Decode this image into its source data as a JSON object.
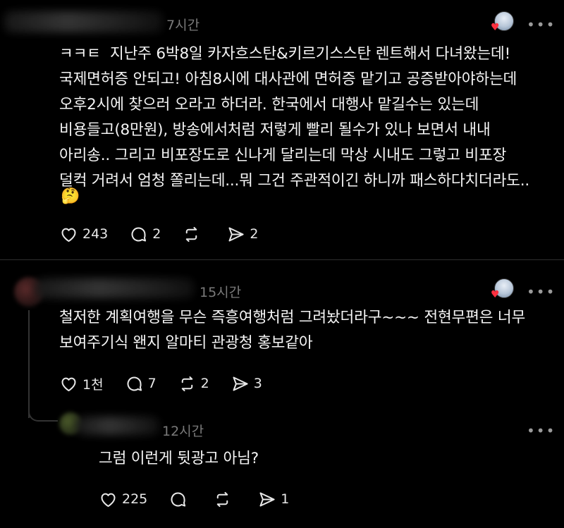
{
  "posts": [
    {
      "time": "7시간",
      "body": "ㅋㅋㅌ  지난주 6박8일 카자흐스탄&키르기스스탄 렌트해서 다녀왔는데!\n국제면허증 안되고! 아침8시에 대사관에 면허증 맡기고 공증받아야하는데\n오후2시에 찾으러 오라고 하더라. 한국에서 대행사 맡길수는 있는데\n비용들고(8만원), 방송에서처럼 저렇게 빨리 될수가 있나 보면서 내내\n아리송.. 그리고 비포장도로 신나게 달리는데 막상 시내도 그렇고 비포장\n덜컥 거려서 엄청 쫄리는데...뭐 그건 주관적이긴 하니까 패스하다치더라도..",
      "emoji": "🤔",
      "likes": "243",
      "comments": "2",
      "reposts": "",
      "shares": "2"
    },
    {
      "time": "15시간",
      "body": "철저한 계획여행을 무슨 즉흥여행처럼 그려놨더라구~~~ 전현무편은 너무\n보여주기식 왠지 알마티 관광청 홍보같아",
      "likes": "1천",
      "comments": "7",
      "reposts": "2",
      "shares": "3"
    },
    {
      "time": "12시간",
      "body": "그럼 이런게 뒷광고 아님?",
      "likes": "225",
      "comments": "",
      "reposts": "",
      "shares": "1"
    }
  ],
  "icons": {
    "like": "heart-icon",
    "comment": "comment-icon",
    "repost": "repost-icon",
    "share": "share-icon",
    "more": "more-icon"
  },
  "more_glyph": "•••",
  "colors": {
    "background": "#000000",
    "text": "#f5f5f5",
    "muted": "#7a7a7a",
    "heart": "#ff3040"
  }
}
